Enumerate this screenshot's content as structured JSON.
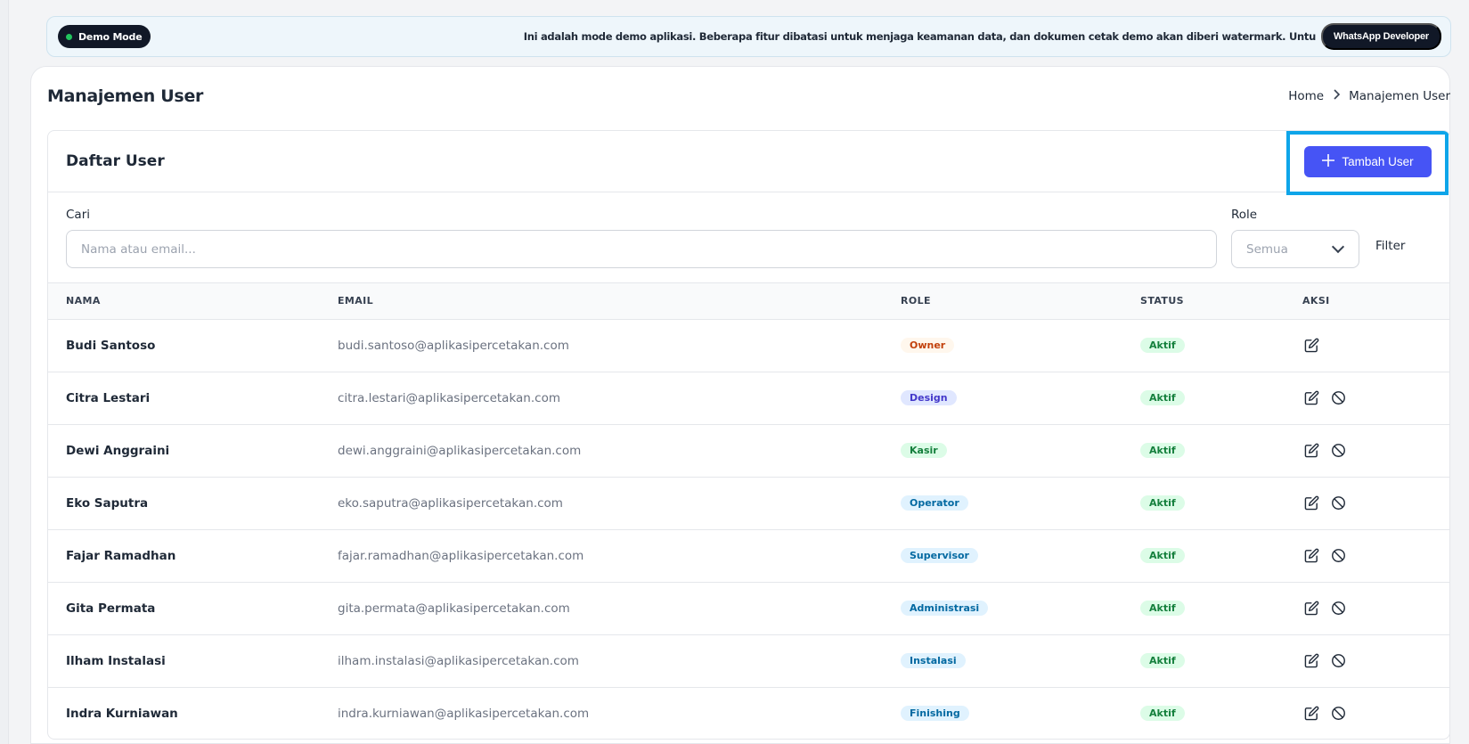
{
  "banner": {
    "demo_label": "Demo Mode",
    "message": "Ini adalah mode demo aplikasi. Beberapa fitur dibatasi untuk menjaga keamanan data, dan dokumen cetak demo akan diberi watermark. Untu",
    "whatsapp_label": "WhatsApp Developer"
  },
  "page": {
    "title": "Manajemen User",
    "breadcrumb": [
      "Home",
      "Manajemen User"
    ]
  },
  "card": {
    "title": "Daftar User",
    "add_button_label": "Tambah User"
  },
  "filters": {
    "search_label": "Cari",
    "search_placeholder": "Nama atau email...",
    "search_value": "",
    "role_label": "Role",
    "role_selected": "Semua",
    "filter_button_label": "Filter"
  },
  "table": {
    "headers": [
      "NAMA",
      "EMAIL",
      "ROLE",
      "STATUS",
      "AKSI"
    ],
    "rows": [
      {
        "name": "Budi Santoso",
        "email": "budi.santoso@aplikasipercetakan.com",
        "role": "Owner",
        "status": "Aktif",
        "can_disable": false
      },
      {
        "name": "Citra Lestari",
        "email": "citra.lestari@aplikasipercetakan.com",
        "role": "Design",
        "status": "Aktif",
        "can_disable": true
      },
      {
        "name": "Dewi Anggraini",
        "email": "dewi.anggraini@aplikasipercetakan.com",
        "role": "Kasir",
        "status": "Aktif",
        "can_disable": true
      },
      {
        "name": "Eko Saputra",
        "email": "eko.saputra@aplikasipercetakan.com",
        "role": "Operator",
        "status": "Aktif",
        "can_disable": true
      },
      {
        "name": "Fajar Ramadhan",
        "email": "fajar.ramadhan@aplikasipercetakan.com",
        "role": "Supervisor",
        "status": "Aktif",
        "can_disable": true
      },
      {
        "name": "Gita Permata",
        "email": "gita.permata@aplikasipercetakan.com",
        "role": "Administrasi",
        "status": "Aktif",
        "can_disable": true
      },
      {
        "name": "Ilham Instalasi",
        "email": "ilham.instalasi@aplikasipercetakan.com",
        "role": "Instalasi",
        "status": "Aktif",
        "can_disable": true
      },
      {
        "name": "Indra Kurniawan",
        "email": "indra.kurniawan@aplikasipercetakan.com",
        "role": "Finishing",
        "status": "Aktif",
        "can_disable": true
      }
    ]
  },
  "colors": {
    "accent": "#4654f5",
    "highlight": "#0ea5e9",
    "role_badges": {
      "Owner": {
        "bg": "#fff7ed",
        "fg": "#c2410c"
      },
      "Design": {
        "bg": "#e0e7ff",
        "fg": "#4338ca"
      },
      "Kasir": {
        "bg": "#dcfce7",
        "fg": "#15803d"
      },
      "Operator": {
        "bg": "#e0f2fe",
        "fg": "#0369a1"
      },
      "Supervisor": {
        "bg": "#e0f2fe",
        "fg": "#0369a1"
      },
      "Administrasi": {
        "bg": "#e0f2fe",
        "fg": "#0369a1"
      },
      "Instalasi": {
        "bg": "#e0f2fe",
        "fg": "#0369a1"
      },
      "Finishing": {
        "bg": "#e0f2fe",
        "fg": "#0369a1"
      }
    }
  },
  "icons": {
    "edit": "edit-icon",
    "disable": "disable-icon",
    "add": "plus-icon",
    "breadcrumb_separator": "chevron-right-icon",
    "dropdown": "chevron-down-icon"
  }
}
